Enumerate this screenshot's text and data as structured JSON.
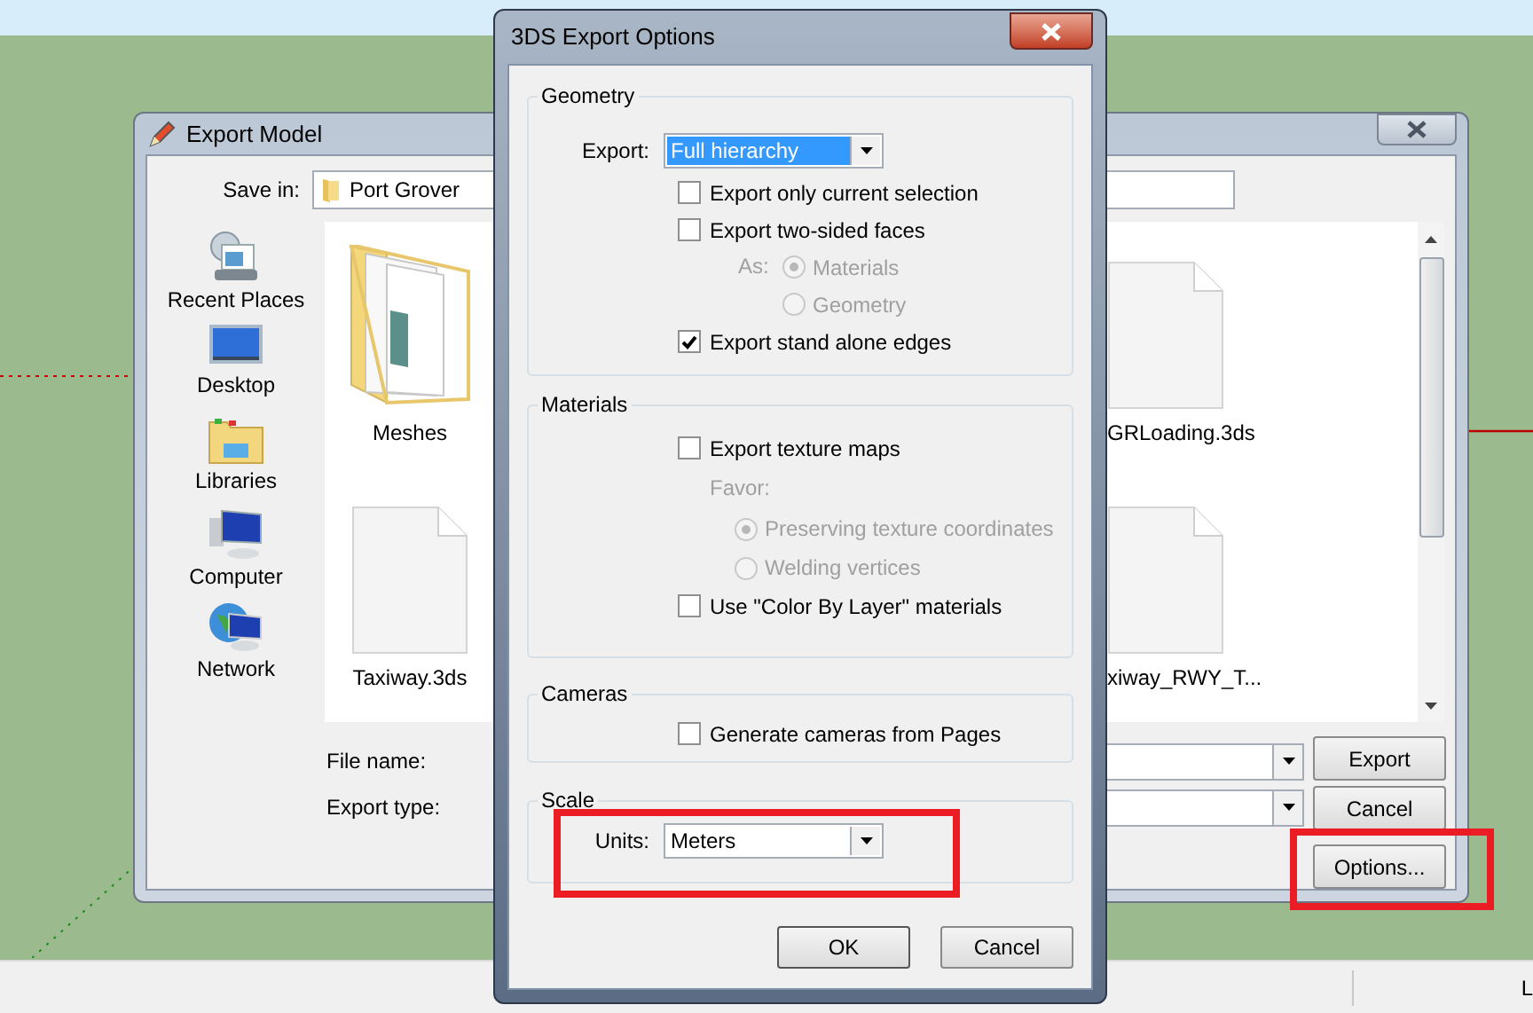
{
  "desktop": {
    "status_text": "L"
  },
  "export_window": {
    "title": "Export Model",
    "save_in": {
      "label": "Save in:",
      "value": "Port Grover"
    },
    "places": [
      {
        "label": "Recent Places",
        "kind": "recent"
      },
      {
        "label": "Desktop",
        "kind": "desktop"
      },
      {
        "label": "Libraries",
        "kind": "libraries"
      },
      {
        "label": "Computer",
        "kind": "computer"
      },
      {
        "label": "Network",
        "kind": "network"
      }
    ],
    "files": [
      {
        "name": "Meshes",
        "kind": "folder"
      },
      {
        "name": "GRLoading.3ds",
        "kind": "file"
      },
      {
        "name": "Taxiway.3ds",
        "kind": "file"
      },
      {
        "name": "xiway_RWY_T...",
        "kind": "file"
      }
    ],
    "fields": [
      {
        "label": "File name:"
      },
      {
        "label": "Export type:"
      }
    ],
    "buttons": [
      "Export",
      "Cancel",
      "Options..."
    ]
  },
  "options_dialog": {
    "title": "3DS Export Options",
    "groups": [
      {
        "legend": "Geometry",
        "items": [
          {
            "kind": "select",
            "label": "Export:",
            "value": "Full hierarchy",
            "focused": true
          },
          {
            "kind": "checkbox",
            "label": "Export only current selection",
            "checked": false
          },
          {
            "kind": "checkbox",
            "label": "Export two-sided faces",
            "checked": false
          },
          {
            "kind": "inline_radios",
            "label": "As:",
            "disabled": true,
            "options": [
              {
                "label": "Materials",
                "selected": true
              },
              {
                "label": "Geometry",
                "selected": false
              }
            ]
          },
          {
            "kind": "checkbox",
            "label": "Export stand alone edges",
            "checked": true
          }
        ]
      },
      {
        "legend": "Materials",
        "items": [
          {
            "kind": "checkbox",
            "label": "Export texture maps",
            "checked": false
          },
          {
            "kind": "stacked_radios",
            "label": "Favor:",
            "disabled": true,
            "options": [
              {
                "label": "Preserving texture coordinates",
                "selected": true
              },
              {
                "label": "Welding vertices",
                "selected": false
              }
            ]
          },
          {
            "kind": "checkbox",
            "label": "Use \"Color By Layer\" materials",
            "checked": false
          }
        ]
      },
      {
        "legend": "Cameras",
        "items": [
          {
            "kind": "checkbox",
            "label": "Generate cameras from Pages",
            "checked": false
          }
        ]
      },
      {
        "legend": "Scale",
        "items": [
          {
            "kind": "select",
            "label": "Units:",
            "value": "Meters",
            "focused": false
          }
        ]
      }
    ],
    "buttons": [
      "OK",
      "Cancel"
    ]
  }
}
